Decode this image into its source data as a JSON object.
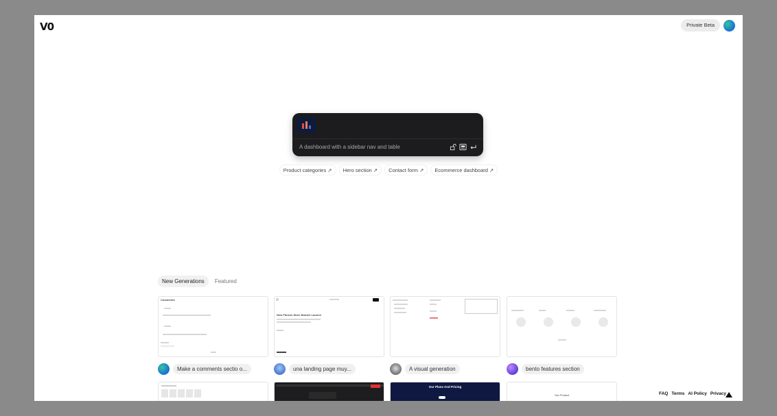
{
  "header": {
    "logo": "V0",
    "beta_badge": "Private Beta"
  },
  "prompt": {
    "text": "A dashboard with a sidebar nav and table"
  },
  "suggestions": [
    "Product categories ↗",
    "Hero section ↗",
    "Contact form ↗",
    "Ecommerce dashboard ↗"
  ],
  "tabs": [
    "New Generations",
    "Featured"
  ],
  "cards": [
    {
      "title": "Comments",
      "caption": "Make a comments sectio o..."
    },
    {
      "title": "New Fitness Store Branch Launch",
      "caption": "una landing page muy..."
    },
    {
      "title": "",
      "caption": "A visual generation"
    },
    {
      "title": "",
      "caption": "bento features section"
    }
  ],
  "row2": [
    {
      "title": ""
    },
    {
      "title": ""
    },
    {
      "title": "Our Plans And Pricing"
    },
    {
      "title": "Our Product"
    }
  ],
  "footer": {
    "links": [
      "FAQ",
      "Terms",
      "AI Policy",
      "Privacy"
    ]
  }
}
